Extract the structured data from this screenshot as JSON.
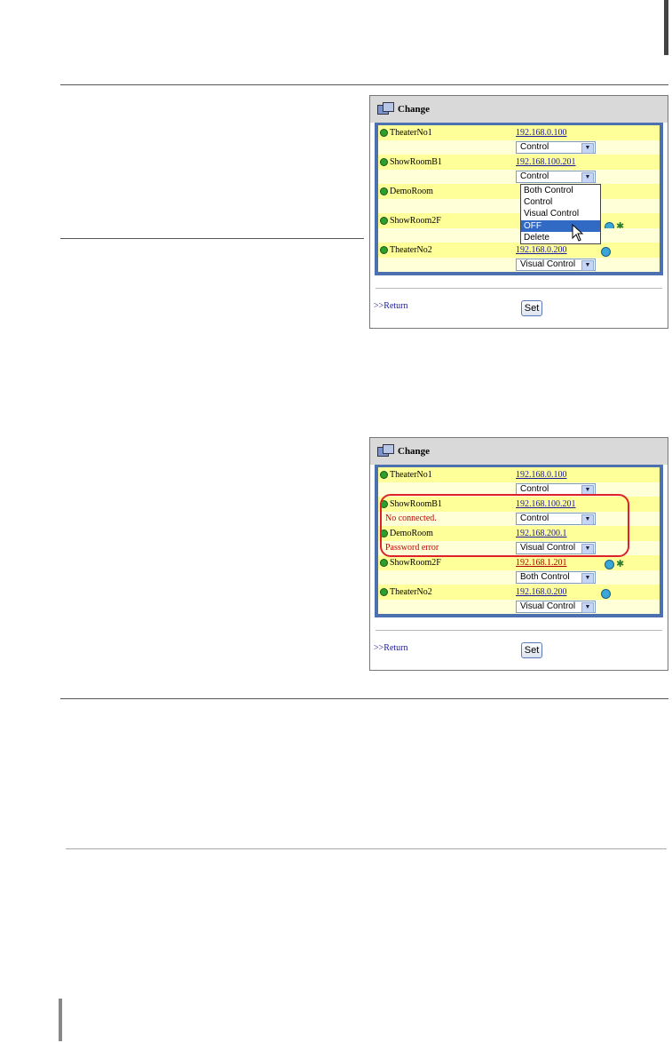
{
  "panel1": {
    "title": "Change",
    "rows": [
      {
        "name": "TheaterNo1",
        "ip": "192.168.0.100",
        "mode": "Control",
        "status": ""
      },
      {
        "name": "ShowRoomB1",
        "ip": "192.168.100.201",
        "mode": "Control",
        "status": ""
      },
      {
        "name": "DemoRoom",
        "ip": "",
        "mode": "",
        "status": ""
      },
      {
        "name": "ShowRoom2F",
        "ip": "",
        "mode": "",
        "status": ""
      },
      {
        "name": "TheaterNo2",
        "ip": "192.168.0.200",
        "mode": "Visual Control",
        "status": ""
      }
    ],
    "dropdown_options": [
      "Both Control",
      "Control",
      "Visual Control",
      "OFF",
      "Delete"
    ],
    "selected_option": "OFF",
    "return_label": ">>Return",
    "set_label": "Set"
  },
  "panel2": {
    "title": "Change",
    "rows": [
      {
        "name": "TheaterNo1",
        "ip": "192.168.0.100",
        "mode": "Control",
        "status": ""
      },
      {
        "name": "ShowRoomB1",
        "ip": "192.168.100.201",
        "mode": "Control",
        "status": "No connected."
      },
      {
        "name": "DemoRoom",
        "ip": "192.168.200.1",
        "mode": "Visual Control",
        "status": "Password error"
      },
      {
        "name": "ShowRoom2F",
        "ip": "192.168.1.201",
        "mode": "Both Control",
        "status": ""
      },
      {
        "name": "TheaterNo2",
        "ip": "192.168.0.200",
        "mode": "Visual Control",
        "status": ""
      }
    ],
    "return_label": ">>Return",
    "set_label": "Set"
  },
  "colors": {
    "frame_blue": "#4c70b0",
    "row_yellow": "#ffff9a",
    "row_light": "#ffffd8",
    "highlight_red": "#e0202a",
    "status_green": "#2e9e2e"
  }
}
